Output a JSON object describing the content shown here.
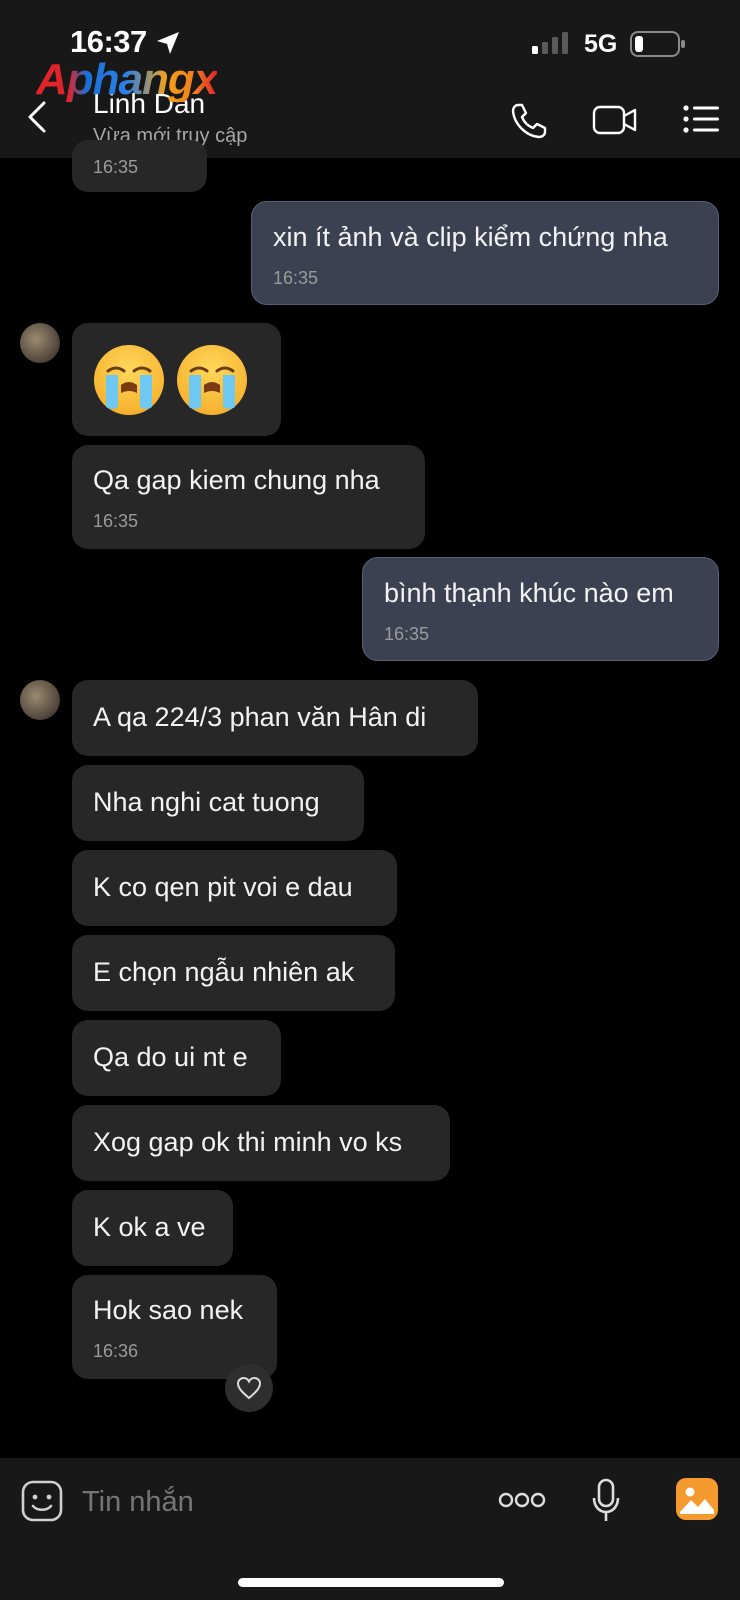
{
  "status_bar": {
    "time": "16:37",
    "network": "5G",
    "battery_level": 0.2
  },
  "watermark": {
    "text": "Aphangx"
  },
  "header": {
    "contact_name": "Linh Dan",
    "contact_status": "Vừa mới truy cập",
    "icons": [
      "back-icon",
      "phone-icon",
      "video-icon",
      "menu-icon"
    ]
  },
  "messages": [
    {
      "side": "in",
      "time": "16:35"
    },
    {
      "side": "out",
      "text": "xin ít ảnh và clip kiểm chứng nha",
      "time": "16:35"
    },
    {
      "side": "in",
      "emoji": [
        "😭",
        "😭"
      ]
    },
    {
      "side": "in",
      "text": "Qa gap kiem chung nha",
      "time": "16:35"
    },
    {
      "side": "out",
      "text": "bình thạnh khúc nào em",
      "time": "16:35"
    },
    {
      "side": "in",
      "text": "A qa 224/3 phan văn Hân di"
    },
    {
      "side": "in",
      "text": "Nha nghi cat tuong"
    },
    {
      "side": "in",
      "text": "K co qen pit voi e dau"
    },
    {
      "side": "in",
      "text": "E chọn ngẫu nhiên ak"
    },
    {
      "side": "in",
      "text": "Qa do ui nt e"
    },
    {
      "side": "in",
      "text": "Xog gap ok thi minh vo ks"
    },
    {
      "side": "in",
      "text": "K ok a ve"
    },
    {
      "side": "in",
      "text": "Hok sao nek",
      "time": "16:36"
    }
  ],
  "composer": {
    "placeholder": "Tin nhắn",
    "icons": [
      "sticker-icon",
      "more-icon",
      "microphone-icon",
      "image-icon"
    ]
  },
  "colors": {
    "background": "#000000",
    "bar_background": "#181818",
    "incoming_bubble": "#272727",
    "outgoing_bubble": "#3b4150",
    "image_button": "#f59a2f"
  }
}
